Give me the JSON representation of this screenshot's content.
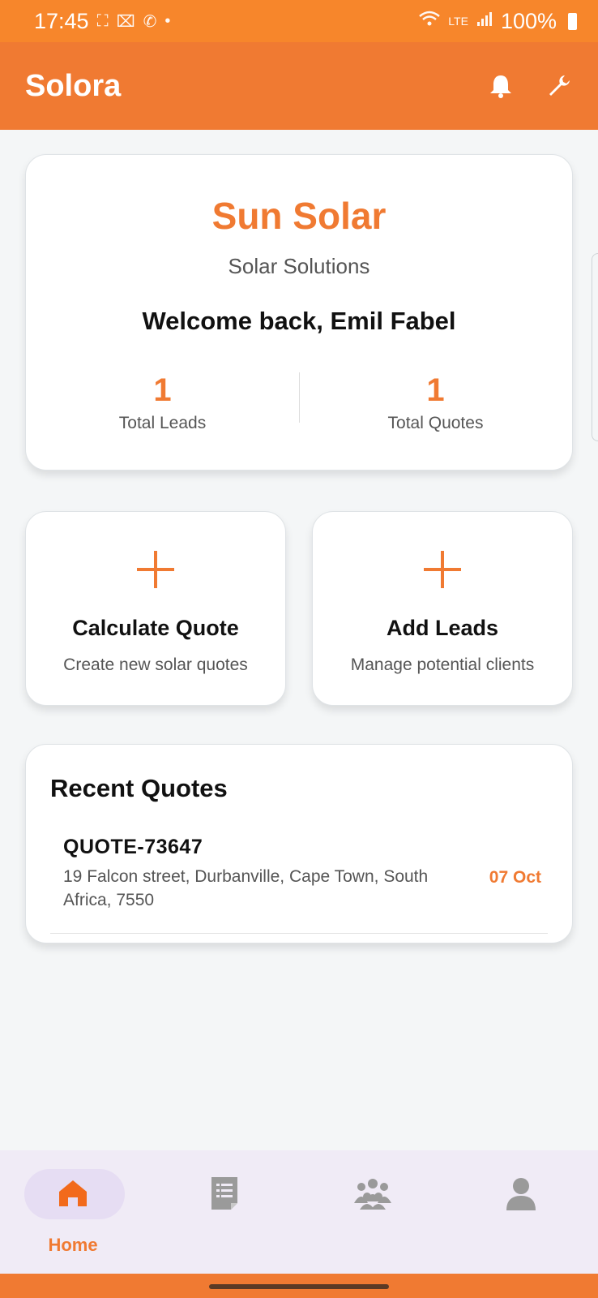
{
  "status_bar": {
    "time": "17:45",
    "battery": "100%",
    "left_icons": [
      "screenshot-icon",
      "scan-icon",
      "whatsapp-icon",
      "dot-icon"
    ],
    "right_icons": [
      "wifi-icon",
      "volte-icon",
      "signal-icon",
      "battery-icon"
    ]
  },
  "app_bar": {
    "title": "Solora",
    "actions": [
      "bell-icon",
      "wrench-icon"
    ]
  },
  "hero": {
    "company": "Sun Solar",
    "tagline": "Solar Solutions",
    "welcome": "Welcome back, Emil Fabel",
    "stats": [
      {
        "value": "1",
        "label": "Total Leads"
      },
      {
        "value": "1",
        "label": "Total Quotes"
      }
    ]
  },
  "actions": [
    {
      "title": "Calculate Quote",
      "subtitle": "Create new solar quotes",
      "icon": "plus-icon"
    },
    {
      "title": "Add Leads",
      "subtitle": "Manage potential clients",
      "icon": "plus-icon"
    }
  ],
  "recent": {
    "title": "Recent Quotes",
    "quotes": [
      {
        "id": "QUOTE-73647",
        "address": "19 Falcon street, Durbanville, Cape Town, South Africa, 7550",
        "date": "07 Oct"
      }
    ]
  },
  "bottom_nav": {
    "items": [
      {
        "label": "Home",
        "icon": "home-icon",
        "active": true
      },
      {
        "label": "",
        "icon": "quotes-document-icon",
        "active": false
      },
      {
        "label": "",
        "icon": "leads-group-icon",
        "active": false
      },
      {
        "label": "",
        "icon": "profile-icon",
        "active": false
      }
    ]
  },
  "colors": {
    "brand_orange": "#f07a32",
    "status_bar_orange": "#f7862b",
    "background": "#f4f6f7",
    "nav_background": "#f0ebf6",
    "nav_pill": "#e6ddf3",
    "inactive_icon": "#9a9a9a"
  }
}
